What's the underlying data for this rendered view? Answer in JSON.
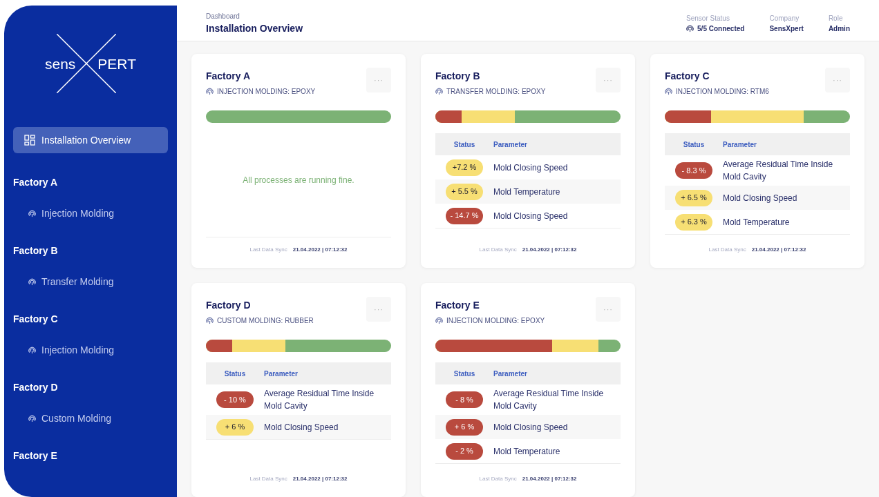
{
  "logo": {
    "left": "sens",
    "right": "PERT"
  },
  "sidebar": {
    "items": [
      {
        "label": "Installation Overview",
        "selected": true
      }
    ],
    "groups": [
      {
        "title": "Factory A",
        "items": [
          {
            "label": "Injection Molding",
            "selected": false
          }
        ]
      },
      {
        "title": "Factory B",
        "items": [
          {
            "label": "Transfer Molding",
            "selected": false
          }
        ]
      },
      {
        "title": "Factory C",
        "items": [
          {
            "label": "Injection Molding",
            "selected": false
          }
        ]
      },
      {
        "title": "Factory D",
        "items": [
          {
            "label": "Custom Molding",
            "selected": false
          }
        ]
      },
      {
        "title": "Factory E"
      }
    ]
  },
  "header": {
    "breadcrumb": "Dashboard",
    "title": "Installation Overview",
    "info": [
      {
        "label": "Sensor Status",
        "value": "5/5 Connected",
        "kind": "sensor"
      },
      {
        "label": "Company",
        "value": "SensXpert",
        "kind": "text"
      },
      {
        "label": "Role",
        "value": "Admin",
        "kind": "text"
      }
    ]
  },
  "cards": [
    {
      "title": "Factory A",
      "process": "INJECTION MOLDING: EPOXY",
      "menu": "···",
      "message": "All processes are running fine.",
      "sync_label": "Last Data Sync",
      "sync_value": "21.04.2022 | 07:12:32"
    },
    {
      "title": "Factory B",
      "process": "TRANSFER MOLDING: EPOXY",
      "menu": "···",
      "segments": [
        {
          "kind": "warning",
          "level": 0.43
        },
        {
          "kind": "critical",
          "level": 0.14
        }
      ],
      "columns": [
        "Status",
        "Parameter"
      ],
      "rows": [
        {
          "status": "+7.2 %",
          "parameter": "Mold Closing Speed",
          "kind": "warning"
        },
        {
          "status": "+ 5.5 %",
          "parameter": "Mold Temperature",
          "kind": "warning"
        },
        {
          "status": "- 14.7 %",
          "parameter": "Mold Closing Speed",
          "kind": "critical"
        }
      ],
      "sync_label": "Last Data Sync",
      "sync_value": "21.04.2022 | 07:12:32"
    },
    {
      "title": "Factory C",
      "process": "INJECTION MOLDING: RTM6",
      "menu": "···",
      "segments": [
        {
          "kind": "warning",
          "level": 0.75
        },
        {
          "kind": "critical",
          "level": 0.25
        }
      ],
      "columns": [
        "Status",
        "Parameter"
      ],
      "rows": [
        {
          "status": "- 8.3 %",
          "parameter": "Average Residual Time Inside Mold Cavity",
          "kind": "critical"
        },
        {
          "status": "+ 6.5 %",
          "parameter": "Mold Closing Speed",
          "kind": "warning"
        },
        {
          "status": "+ 6.3 %",
          "parameter": "Mold Temperature",
          "kind": "warning"
        }
      ],
      "sync_label": "Last Data Sync",
      "sync_value": "21.04.2022 | 07:12:32"
    },
    {
      "title": "Factory D",
      "process": "CUSTOM MOLDING: RUBBER",
      "menu": "···",
      "segments": [
        {
          "kind": "warning",
          "level": 0.43
        },
        {
          "kind": "critical",
          "level": 0.14
        }
      ],
      "columns": [
        "Status",
        "Parameter"
      ],
      "rows": [
        {
          "status": "- 10 %",
          "parameter": "Average Residual Time Inside Mold Cavity",
          "kind": "critical"
        },
        {
          "status": "+ 6 %",
          "parameter": "Mold Closing Speed",
          "kind": "warning"
        }
      ],
      "sync_label": "Last Data Sync",
      "sync_value": "21.04.2022 | 07:12:32"
    },
    {
      "title": "Factory E",
      "process": "INJECTION MOLDING: EPOXY",
      "menu": "···",
      "segments": [
        {
          "kind": "warning",
          "level": 0.88
        },
        {
          "kind": "critical",
          "level": 0.63
        }
      ],
      "columns": [
        "Status",
        "Parameter"
      ],
      "rows": [
        {
          "status": "- 8 %",
          "parameter": "Average Residual Time Inside Mold Cavity",
          "kind": "critical"
        },
        {
          "status": "+ 6 %",
          "parameter": "Mold Closing Speed",
          "kind": "critical"
        },
        {
          "status": "- 2 %",
          "parameter": "Mold Temperature",
          "kind": "critical"
        }
      ],
      "sync_label": "Last Data Sync",
      "sync_value": "21.04.2022 | 07:12:32"
    }
  ]
}
